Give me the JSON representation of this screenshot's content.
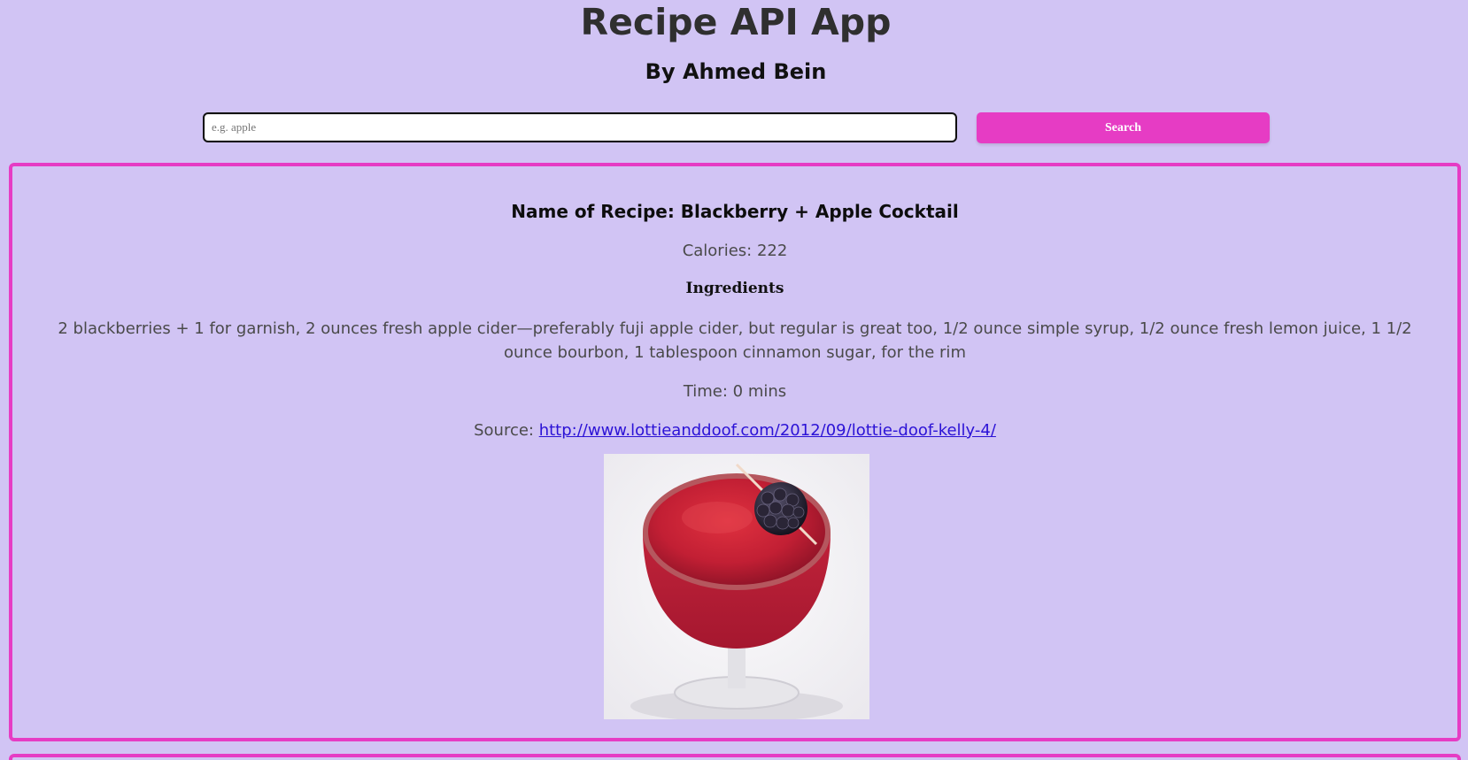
{
  "header": {
    "title": "Recipe API App",
    "byline": "By Ahmed Bein"
  },
  "search": {
    "placeholder": "e.g. apple",
    "value": "",
    "button_label": "Search"
  },
  "recipe": {
    "name": "Name of Recipe: Blackberry + Apple Cocktail",
    "calories": "Calories: 222",
    "ingredients_heading": "Ingredients",
    "ingredients": "2 blackberries + 1 for garnish, 2 ounces fresh apple cider—preferably fuji apple cider, but regular is great too, 1/2 ounce simple syrup, 1/2 ounce fresh lemon juice, 1 1/2 ounce bourbon, 1 tablespoon cinnamon sugar, for the rim",
    "time": "Time: 0 mins",
    "source_prefix": "Source: ",
    "source_url": "http://www.lottieanddoof.com/2012/09/lottie-doof-kelly-4/"
  },
  "colors": {
    "background": "#d1c4f4",
    "accent": "#e63cc4",
    "link": "#2b12d6"
  },
  "icons": {
    "recipe_image": "cocktail-photo"
  }
}
